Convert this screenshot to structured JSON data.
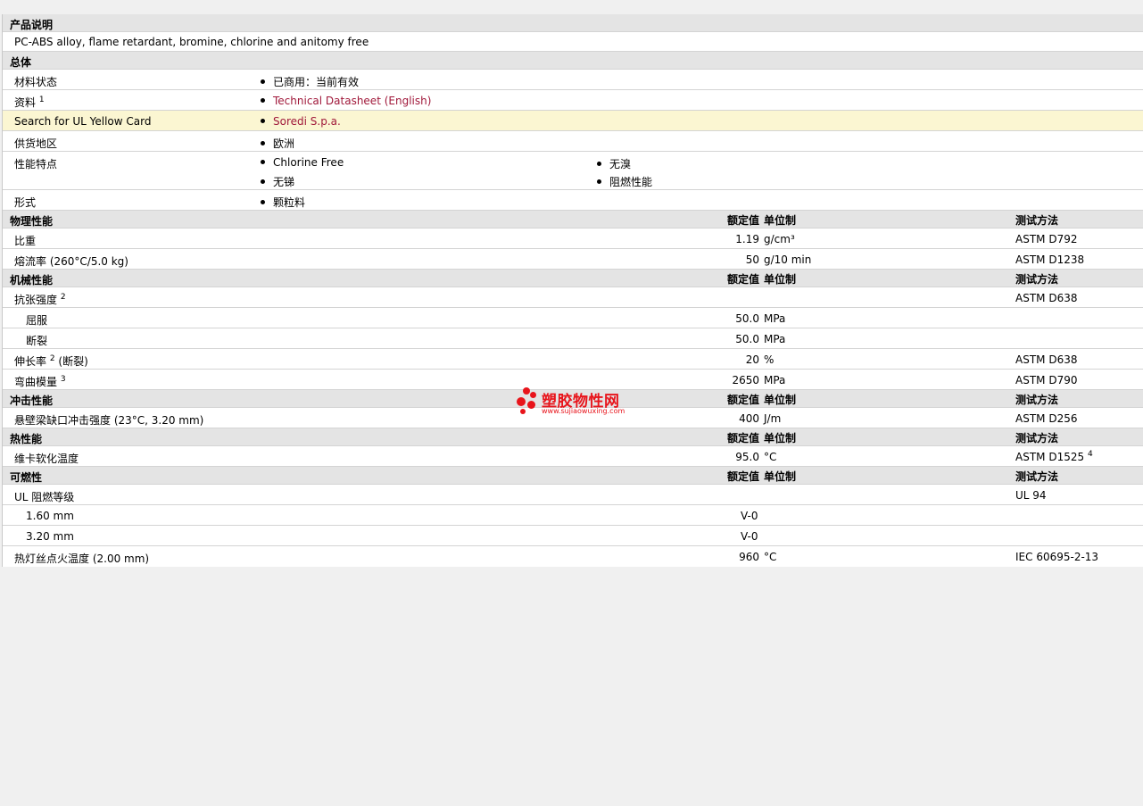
{
  "description": {
    "header": "产品说明",
    "text": "PC-ABS alloy, flame retardant, bromine, chlorine and anitomy free"
  },
  "general": {
    "header": "总体",
    "rows": [
      {
        "label": "材料状态",
        "sup": "",
        "items": [
          "已商用：当前有效"
        ]
      },
      {
        "label": "资料",
        "sup": "1",
        "items": [
          "Technical Datasheet (English)"
        ]
      },
      {
        "label": "Search for UL Yellow Card",
        "sup": "",
        "items": [
          "Soredi S.p.a."
        ]
      },
      {
        "label": "供货地区",
        "sup": "",
        "items": [
          "欧洲"
        ]
      },
      {
        "label": "性能特点",
        "sup": "",
        "items": [
          "Chlorine Free",
          "无锑",
          "无溴",
          "阻燃性能"
        ]
      },
      {
        "label": "形式",
        "sup": "",
        "items": [
          "颗粒料"
        ]
      }
    ]
  },
  "col_headers": {
    "value": "额定值",
    "unit": "单位制",
    "test": "测试方法"
  },
  "physical": {
    "header": "物理性能",
    "rows": [
      {
        "label": "比重",
        "value": "1.19",
        "unit": "g/cm³",
        "test": "ASTM D792"
      },
      {
        "label": "熔流率 (260°C/5.0 kg)",
        "value": "50",
        "unit": "g/10 min",
        "test": "ASTM D1238"
      }
    ]
  },
  "mechanical": {
    "header": "机械性能",
    "rows": [
      {
        "label": "抗张强度",
        "sup": "2",
        "value": "",
        "unit": "",
        "test": "ASTM D638"
      },
      {
        "label": "屈服",
        "value": "50.0",
        "unit": "MPa",
        "test": ""
      },
      {
        "label": "断裂",
        "value": "50.0",
        "unit": "MPa",
        "test": ""
      },
      {
        "label": "伸长率",
        "sup": "2",
        "suffix": "(断裂)",
        "value": "20",
        "unit": "%",
        "test": "ASTM D638"
      },
      {
        "label": "弯曲模量",
        "sup": "3",
        "value": "2650",
        "unit": "MPa",
        "test": "ASTM D790"
      }
    ]
  },
  "impact": {
    "header": "冲击性能",
    "rows": [
      {
        "label": "悬壁梁缺口冲击强度 (23°C, 3.20 mm)",
        "value": "400",
        "unit": "J/m",
        "test": "ASTM D256"
      }
    ]
  },
  "thermal": {
    "header": "热性能",
    "rows": [
      {
        "label": "维卡软化温度",
        "value": "95.0",
        "unit": "°C",
        "test": "ASTM D1525",
        "test_sup": "4"
      }
    ]
  },
  "flammability": {
    "header": "可燃性",
    "rows": [
      {
        "label": "UL 阻燃等级",
        "value": "",
        "unit": "",
        "test": "UL 94"
      },
      {
        "label": "1.60 mm",
        "value": "V-0",
        "unit": "",
        "test": ""
      },
      {
        "label": "3.20 mm",
        "value": "V-0",
        "unit": "",
        "test": ""
      },
      {
        "label": "热灯丝点火温度 (2.00 mm)",
        "value": "960",
        "unit": "°C",
        "test": "IEC 60695-2-13"
      }
    ]
  },
  "watermark": {
    "name": "塑胶物性网",
    "url": "www.sujiaowuxing.com"
  },
  "colors": {
    "link": "#a0183a",
    "highlight_row": "#fbf6d2",
    "section_bg": "#e4e4e4",
    "watermark": "#e8141b"
  }
}
